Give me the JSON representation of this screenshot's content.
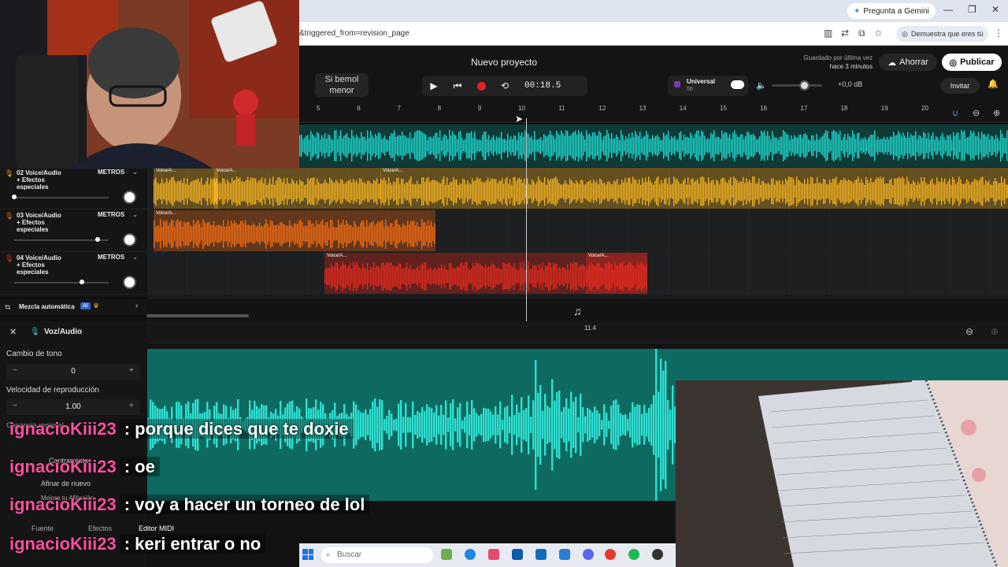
{
  "browser": {
    "gemini_button": "Pregunta a Gemini",
    "url_fragment": "&triggered_from=revision_page",
    "captcha_text": "Demuestra que eres tú"
  },
  "header": {
    "project_title": "Nuevo proyecto",
    "key_line1": "Si bemol",
    "key_line2": "menor",
    "time": "00:18.5",
    "universal_label": "Universal",
    "universal_value": "50",
    "db_value": "+0,0 dB",
    "saved_line1": "Guardado por última vez",
    "saved_line2": "hace 3 minutos",
    "save_button": "Ahorrar",
    "publish_button": "Publicar",
    "invite_button": "Invitar"
  },
  "ruler": {
    "ticks": [
      "5",
      "6",
      "7",
      "8",
      "9",
      "10",
      "11",
      "12",
      "13",
      "14",
      "15",
      "16",
      "17",
      "18",
      "19",
      "20"
    ]
  },
  "tracks": [
    {
      "number": "02",
      "name": "Voice/Audio\n+ Efectos especiales",
      "metros": "METROS",
      "color": "#f0b020",
      "slider": 0.0
    },
    {
      "number": "03",
      "name": "Voice/Audio\n+ Efectos especiales",
      "metros": "METROS",
      "color": "#ee6a14",
      "slider": 0.88
    },
    {
      "number": "04",
      "name": "Voice/Audio\n+ Efectos especiales",
      "metros": "METROS",
      "color": "#e02a1e",
      "slider": 0.72
    }
  ],
  "clips": {
    "label": "Voice/A...",
    "top_track_color": "#1fd6cc"
  },
  "automix": {
    "label": "Mezcla automática",
    "badge": "AI"
  },
  "editor": {
    "title": "Voz/Audio",
    "pitch_label": "Cambio de tono",
    "pitch_value": "0",
    "speed_label": "Velocidad de reproducción",
    "speed_value": "1.00",
    "gain_label": "Ganancia regional",
    "counter_label": "Contrarrestar",
    "retune_label": "Afinar de nuevo",
    "upgrade_label": "Mejora tu Afiliación",
    "marker": "11.4",
    "tabs": [
      "Fuente",
      "Efectos",
      "Editor MIDI"
    ]
  },
  "taskbar": {
    "search_placeholder": "Buscar"
  },
  "chat": [
    {
      "user": "ignacioKiii23",
      "msg": ": porque dices que te doxie"
    },
    {
      "user": "ignacioKiii23",
      "msg": ": oe"
    },
    {
      "user": "ignacioKiii23",
      "msg": ": voy a hacer un torneo de lol"
    },
    {
      "user": "ignacioKiii23",
      "msg": ": keri entrar o no"
    }
  ]
}
